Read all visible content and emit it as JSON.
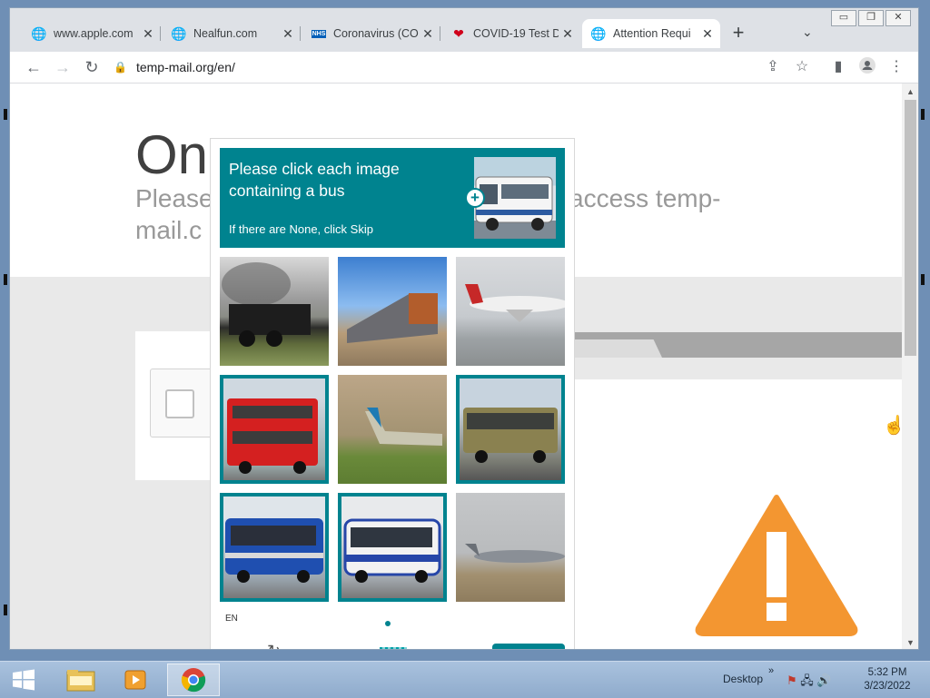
{
  "browser": {
    "tabs": [
      {
        "title": "www.apple.com",
        "icon": "globe-icon"
      },
      {
        "title": "Nealfun.com",
        "icon": "globe-icon"
      },
      {
        "title": "Coronavirus (CO",
        "icon": "nhs-icon",
        "icon_text": "NHS"
      },
      {
        "title": "COVID-19 Test D",
        "icon": "heart-icon"
      },
      {
        "title": "Attention Requi",
        "icon": "globe-icon"
      }
    ],
    "active_tab_index": 4,
    "address": "temp-mail.org/en/"
  },
  "page": {
    "heading_partial": "On",
    "subtitle_left_1": "Please",
    "subtitle_left_2": "mail.c",
    "subtitle_right": "access temp-"
  },
  "captcha": {
    "prompt_line": "Please click each image containing a bus",
    "skip_hint": "If there are None, click Skip",
    "language": "EN",
    "accent_color": "#00838f",
    "images": [
      {
        "subject": "steam train",
        "selected": false
      },
      {
        "subject": "freight train",
        "selected": false
      },
      {
        "subject": "airplane",
        "selected": false
      },
      {
        "subject": "red double-decker bus",
        "selected": true
      },
      {
        "subject": "airplane taking off",
        "selected": false
      },
      {
        "subject": "olive bus",
        "selected": true
      },
      {
        "subject": "blue bus",
        "selected": true
      },
      {
        "subject": "blue articulated bus",
        "selected": true
      },
      {
        "subject": "jet on runway",
        "selected": false
      }
    ]
  },
  "taskbar": {
    "desktop_label": "Desktop",
    "time": "5:32 PM",
    "date": "3/23/2022"
  }
}
